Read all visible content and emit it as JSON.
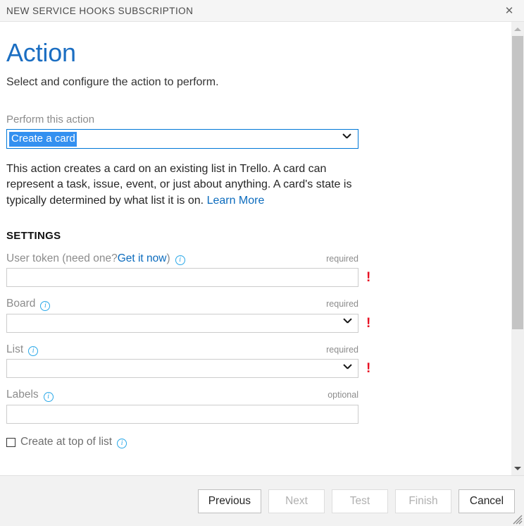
{
  "window": {
    "title": "NEW SERVICE HOOKS SUBSCRIPTION",
    "close_label": "✕"
  },
  "page": {
    "title": "Action",
    "subtitle": "Select and configure the action to perform."
  },
  "action_select": {
    "label": "Perform this action",
    "selected_value": "Create a card",
    "chevron": "chevron-down-icon"
  },
  "description": {
    "text": "This action creates a card on an existing list in Trello. A card can represent a task, issue, event, or just about anything. A card's state is typically determined by what list it is on. ",
    "link_text": "Learn More"
  },
  "settings": {
    "heading": "SETTINGS",
    "fields": [
      {
        "label_prefix": "User token (need one? ",
        "label_link": "Get it now",
        "label_suffix": ")",
        "requirement": "required",
        "control": "text",
        "value": "",
        "placeholder": "",
        "has_error": true,
        "error_mark": "!",
        "info": "info-icon"
      },
      {
        "label_prefix": "Board",
        "label_link": "",
        "label_suffix": "",
        "requirement": "required",
        "control": "select",
        "value": "",
        "placeholder": "",
        "has_error": true,
        "error_mark": "!",
        "info": "info-icon"
      },
      {
        "label_prefix": "List",
        "label_link": "",
        "label_suffix": "",
        "requirement": "required",
        "control": "select",
        "value": "",
        "placeholder": "",
        "has_error": true,
        "error_mark": "!",
        "info": "info-icon"
      },
      {
        "label_prefix": "Labels",
        "label_link": "",
        "label_suffix": "",
        "requirement": "optional",
        "control": "text",
        "value": "",
        "placeholder": "",
        "has_error": false,
        "error_mark": "",
        "info": "info-icon"
      }
    ],
    "checkbox": {
      "label": "Create at top of list",
      "checked": false,
      "info": "info-icon"
    }
  },
  "footer": {
    "buttons": [
      {
        "label": "Previous",
        "disabled": false
      },
      {
        "label": "Next",
        "disabled": true
      },
      {
        "label": "Test",
        "disabled": true
      },
      {
        "label": "Finish",
        "disabled": true
      },
      {
        "label": "Cancel",
        "disabled": false
      }
    ]
  },
  "colors": {
    "accent_blue": "#1b6ec2",
    "link_blue": "#0b6bbd",
    "info_blue": "#2aa8e8",
    "selection_blue": "#3390f0",
    "error_red": "#e81123",
    "titlebar_bg": "#f5f5f5",
    "footer_bg": "#f2f2f2"
  }
}
